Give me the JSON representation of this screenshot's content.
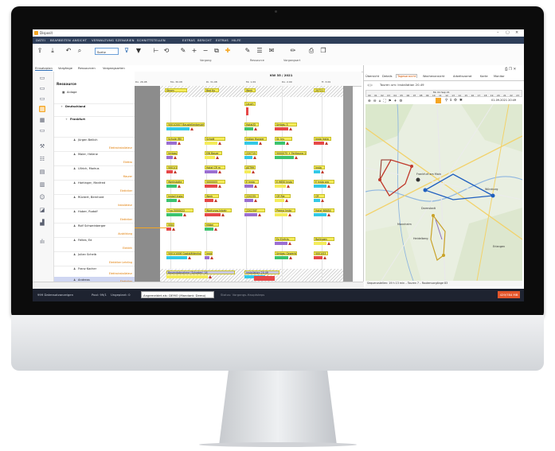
{
  "app": {
    "title": "Disposit"
  },
  "menu": [
    "DATEI",
    "BEARBEITEN",
    "ANSICHT",
    "VERWALTUNG",
    "SZENARIEN",
    "SCHNITTSTELLEN",
    "EXTRAS",
    "BERICHT",
    "EXTRAS",
    "HILFE"
  ],
  "ribbon": {
    "combo_value": "Sortiz",
    "groups": [
      "Vorgang",
      "Ressource",
      "Vorgangsart"
    ]
  },
  "left_tabs": [
    "Einsatzplan",
    "Vorgänge",
    "Ressourcen",
    "Vorgangsarten"
  ],
  "resource_tree": {
    "header": "Ressource",
    "rows": [
      {
        "name": "Anlage",
        "sub": ""
      },
      {
        "name": "Deutschland",
        "sub": ""
      },
      {
        "name": "Frankfurt",
        "sub": ""
      },
      {
        "name": "Jürgen Bellich",
        "sub": "Elektroinstallateur"
      },
      {
        "name": "Maier, Helene",
        "sub": "Elektro"
      },
      {
        "name": "Ullrich, Markus",
        "sub": "Maurer"
      },
      {
        "name": "Hartinger, Manfred",
        "sub": "Elektriker"
      },
      {
        "name": "Rückert, Bernhard",
        "sub": "Installateur"
      },
      {
        "name": "Huber, Rudolf",
        "sub": "Elektriker"
      },
      {
        "name": "Rolf Schweinberger",
        "sub": "Ausbildung"
      },
      {
        "name": "Feltes, Ed",
        "sub": "Elektrik"
      },
      {
        "name": "Julian Scheib",
        "sub": "Elektriker Lehrling"
      },
      {
        "name": "Franz Kocher",
        "sub": "Elektroinstallateur"
      },
      {
        "name": "Andreas",
        "sub": "Elektriker"
      }
    ]
  },
  "gantt": {
    "week_label": "KW 35 / 2021",
    "days": [
      "Do. 26.08",
      "Mo. 30.08",
      "Di. 31.08",
      "Mi. 1.09",
      "Do. 2.09",
      "Fr. 3.09"
    ],
    "bars": [
      {
        "label": "Strom",
        "row": 0
      },
      {
        "label": "Bad Ku",
        "row": 0
      },
      {
        "label": "Werk",
        "row": 0
      },
      {
        "label": "20721",
        "row": 0
      },
      {
        "label": "Leuch",
        "row": 2
      },
      {
        "label": "5001/2007  Baustellenbesichtung",
        "row": 3
      },
      {
        "label": "Hotel/D",
        "row": 3
      },
      {
        "label": "Umbau 3",
        "row": 3
      },
      {
        "label": "Schule (RI)",
        "row": 4
      },
      {
        "label": "Schott",
        "row": 4
      },
      {
        "label": "Indian Hunger",
        "row": 4
      },
      {
        "label": "St. Ins",
        "row": 4
      },
      {
        "label": "Insta Insta",
        "row": 4
      },
      {
        "label": "Umbau",
        "row": 5
      },
      {
        "label": "EW Bauer",
        "row": 5
      },
      {
        "label": "220715",
        "row": 5
      },
      {
        "label": "5000075 + Fertigung 12 A",
        "row": 5
      },
      {
        "label": "5001/12",
        "row": 6
      },
      {
        "label": "Hotel CR m",
        "row": 6
      },
      {
        "label": "AST99",
        "row": 6
      },
      {
        "label": "Insta",
        "row": 6
      },
      {
        "label": "Werkstatte",
        "row": 7
      },
      {
        "label": "5000005",
        "row": 7
      },
      {
        "label": "E Insta",
        "row": 7
      },
      {
        "label": "E-9650 Insta",
        "row": 7
      },
      {
        "label": "E Insta pro",
        "row": 7
      },
      {
        "label": "Install Insta",
        "row": 8
      },
      {
        "label": "Werk",
        "row": 8
      },
      {
        "label": "220235",
        "row": 8
      },
      {
        "label": "CR Rie",
        "row": 8
      },
      {
        "label": "CR",
        "row": 8
      },
      {
        "label": "Tvo-5000022",
        "row": 9
      },
      {
        "label": "Wartungs-Inbetr",
        "row": 9
      },
      {
        "label": "220230F",
        "row": 9
      },
      {
        "label": "Prema Insta",
        "row": 9
      },
      {
        "label": "Hotel 66484",
        "row": 9
      },
      {
        "label": "Mittel",
        "row": 10
      },
      {
        "label": "550484",
        "row": 10
      },
      {
        "label": "Ex Einfr.ts",
        "row": 11
      },
      {
        "label": "Rollingen",
        "row": 11
      },
      {
        "label": "5001/1006  Gaststättenhandh",
        "row": 12
      },
      {
        "label": "Umbau Gewerbe",
        "row": 12
      },
      {
        "label": "5001/03",
        "row": 12
      },
      {
        "label": "Installation",
        "row": 12
      },
      {
        "label": "Bauendabnahme (Schaden) 18",
        "row": 13
      },
      {
        "label": "Installation 20.49",
        "row": 13
      }
    ]
  },
  "right_panel": {
    "tabs": [
      "Übersicht",
      "Details",
      "Tagesansicht",
      "Wochenansicht",
      "Arbeitsvorrat",
      "Karte",
      "Monitor"
    ],
    "active_tab": "Tagesansicht",
    "tour_title": "Touren um: Installation 20.49",
    "ruler_date": "Mi. 01 Sep 21",
    "ruler_hours": [
      "00",
      "01",
      "02",
      "03",
      "04",
      "05",
      "06",
      "07",
      "08",
      "09",
      "10",
      "11",
      "12",
      "13",
      "14",
      "15",
      "16",
      "17",
      "18",
      "19",
      "20",
      "21",
      "22",
      "23"
    ],
    "date_field": "01.09.2021 20:49",
    "map_places": [
      "Frankfurt am Main",
      "Darmstadt",
      "Würzburg",
      "Erlangen",
      "Heidelberg",
      "Mannheim"
    ],
    "map_status": "Sequenzstellen: 19 h 13 min – Touren 7 – Routenvorgänge 83"
  },
  "statusbar": {
    "left_text": "999 Datensatzanzeigen",
    "pool_text": "Pool: 99/1",
    "ungeplant": "Ungeplant: 0",
    "user_dropdown": "Angemeldet als: DEMO (Mandant: Demo)",
    "status_hint": "Status: Vorgangs-Hauptsteps",
    "memory": "429/784 MB"
  },
  "colors": {
    "menubar": "#2e3e59",
    "accent": "#f5a623",
    "bar_yellow": "#f4ec5a",
    "bar_cyan": "#33c9e6",
    "bar_green": "#3cc36f",
    "bar_red": "#e64848",
    "route_red": "#c0392b",
    "route_blue": "#1f5fbf",
    "route_gold": "#c9a227"
  }
}
